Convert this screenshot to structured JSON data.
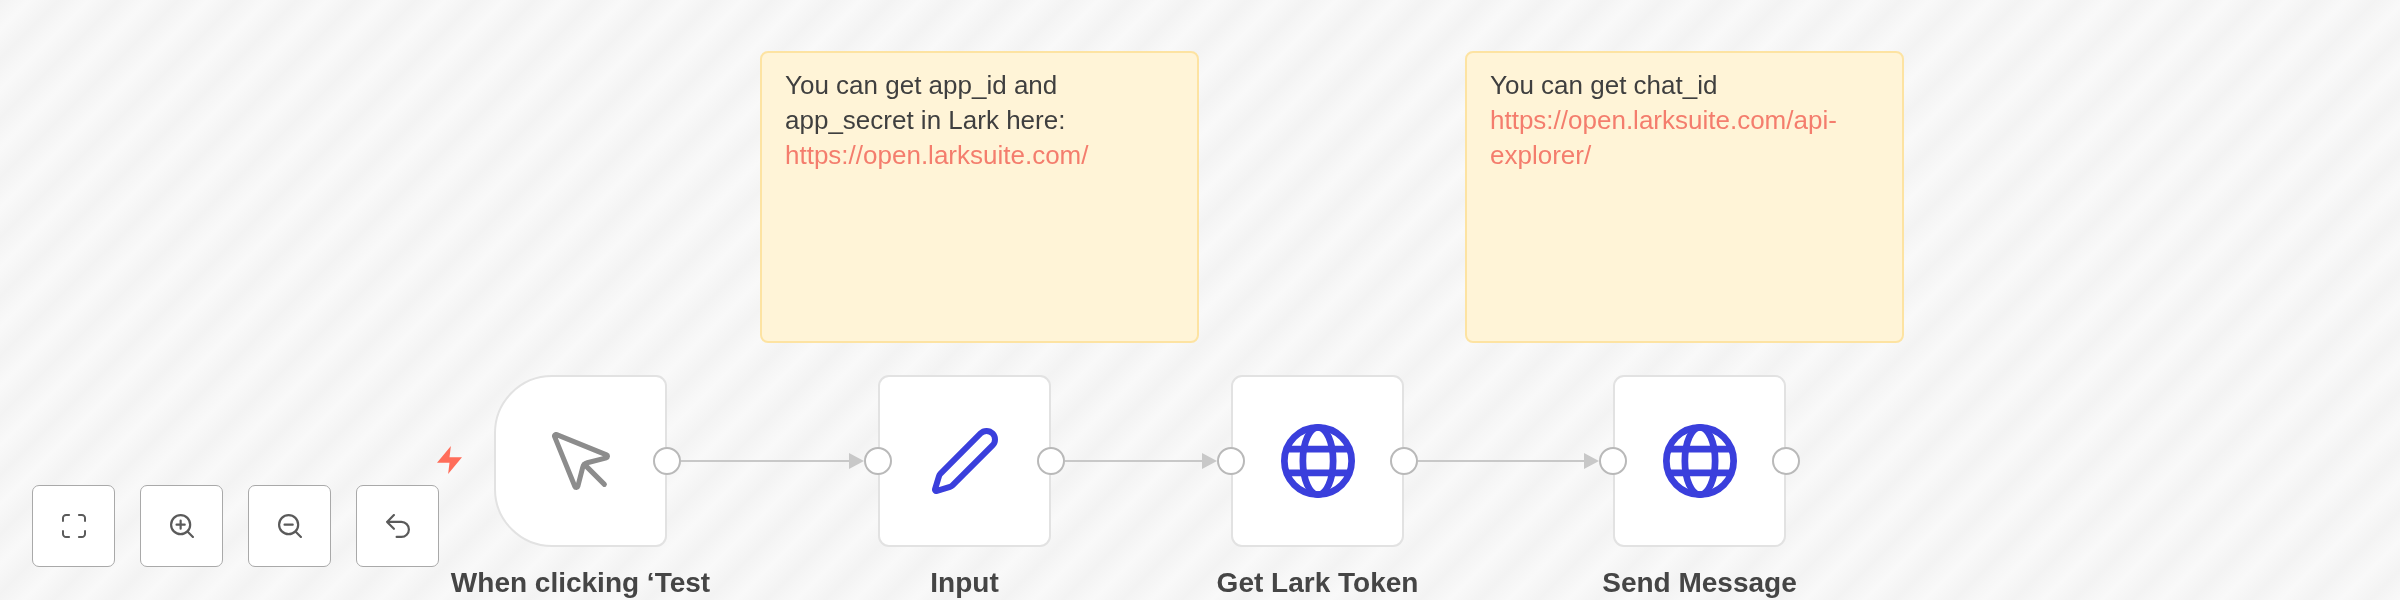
{
  "canvas": {
    "sticky_notes": [
      {
        "text": "You can get app_id and app_secret in Lark here:",
        "link": "https://open.larksuite.com/"
      },
      {
        "text": "You can get chat_id",
        "link": "https://open.larksuite.com/api-explorer/"
      }
    ],
    "nodes": [
      {
        "kind": "trigger",
        "label": "When clicking ‘Test"
      },
      {
        "kind": "edit",
        "label": "Input"
      },
      {
        "kind": "http",
        "label": "Get Lark Token"
      },
      {
        "kind": "http",
        "label": "Send Message"
      }
    ],
    "controls": [
      {
        "kind": "fit"
      },
      {
        "kind": "zoomin"
      },
      {
        "kind": "zoomout"
      },
      {
        "kind": "reset"
      }
    ]
  }
}
